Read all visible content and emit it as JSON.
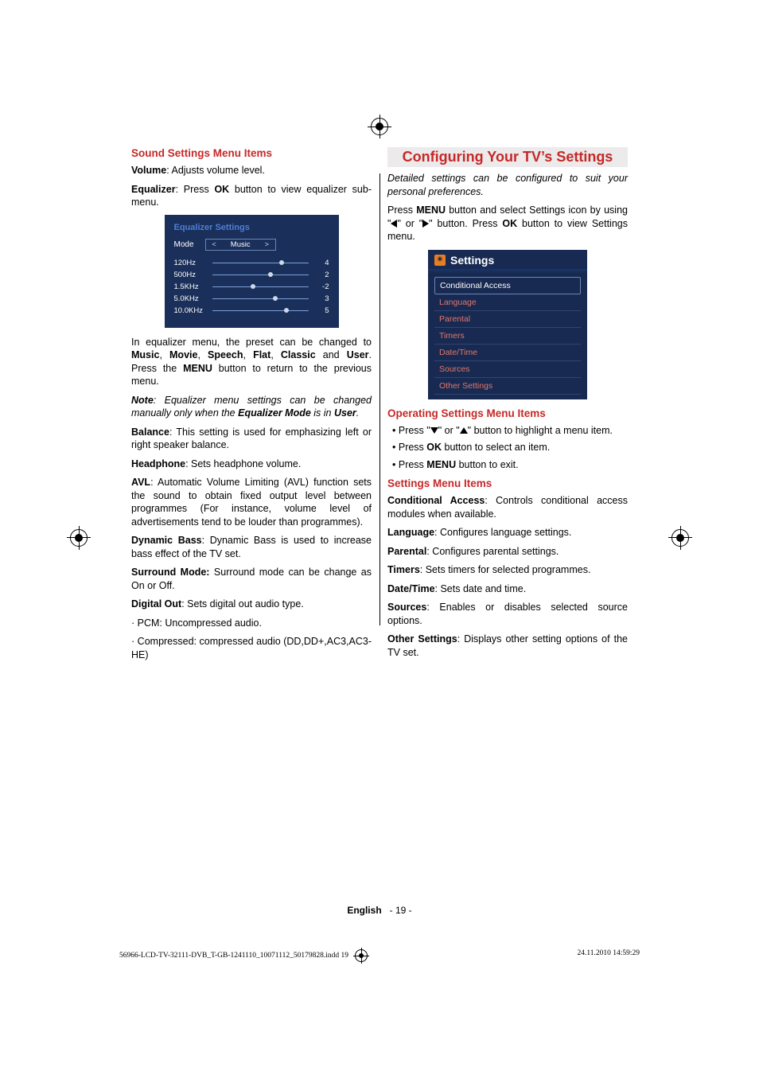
{
  "left": {
    "heading_sound": "Sound Settings Menu Items",
    "p_volume_b": "Volume",
    "p_volume_rest": ": Adjusts volume level.",
    "p_equalizer_b": "Equalizer",
    "p_equalizer_mid1": ": Press ",
    "p_equalizer_ok": "OK",
    "p_equalizer_rest": " button to view equalizer sub-menu.",
    "eq": {
      "title": "Equalizer Settings",
      "mode_label": "Mode",
      "mode_value": "Music",
      "bands": [
        {
          "label": "120Hz",
          "value": "4",
          "dot_pct": 70
        },
        {
          "label": "500Hz",
          "value": "2",
          "dot_pct": 58
        },
        {
          "label": "1.5KHz",
          "value": "-2",
          "dot_pct": 40
        },
        {
          "label": "5.0KHz",
          "value": "3",
          "dot_pct": 63
        },
        {
          "label": "10.0KHz",
          "value": "5",
          "dot_pct": 75
        }
      ]
    },
    "p_inmenu_1": "In equalizer menu, the preset can be changed to ",
    "p_inmenu_music": "Music",
    "p_inmenu_c": ", ",
    "p_inmenu_movie": "Movie",
    "p_inmenu_speech": "Speech",
    "p_inmenu_flat": "Flat",
    "p_inmenu_classic": "Classic",
    "p_inmenu_and": " and ",
    "p_inmenu_user": "User",
    "p_inmenu_2a": ". Press the ",
    "p_inmenu_menu": "MENU",
    "p_inmenu_2b": " button to return to the previous menu.",
    "note_label": "Note",
    "note_1": ": Equalizer menu settings can be changed manually only when the ",
    "note_eqmode": "Equalizer Mode",
    "note_isin": " is in ",
    "note_user": "User",
    "note_dot": ".",
    "balance_b": "Balance",
    "balance_rest": ": This setting is used for emphasizing left or right speaker balance.",
    "headphone_b": "Headphone",
    "headphone_rest": ": Sets headphone volume.",
    "avl_b": "AVL",
    "avl_rest": ": Automatic Volume Limiting (AVL) function sets the sound to obtain fixed output level between programmes (For instance, volume level of advertisements tend to be louder than programmes).",
    "dyn_b": "Dynamic Bass",
    "dyn_rest": ": Dynamic Bass is used to increase bass effect of the TV set.",
    "surround_b": "Surround Mode:",
    "surround_rest": " Surround mode can be change as On or Off.",
    "digital_b": "Digital Out",
    "digital_rest": ": Sets digital out audio type.",
    "pcm": "· PCM: Uncompressed audio.",
    "compressed": "· Compressed: compressed audio (DD,DD+,AC3,AC3-HE)"
  },
  "right": {
    "banner": "Configuring Your TV’s Settings",
    "detailed": "Detailed settings can be configured to suit your personal preferences.",
    "p_press1": "Press ",
    "p_menu": "MENU",
    "p_press2": " button and select Settings icon by using \"",
    "p_or": "\" or \"",
    "p_press3": "\" button. Press ",
    "p_ok": "OK",
    "p_press4": " button to view Settings menu.",
    "settings_title": "Settings",
    "settings_items": [
      "Conditional Access",
      "Language",
      "Parental",
      "Timers",
      "Date/Time",
      "Sources",
      "Other Settings"
    ],
    "op_heading": "Operating Settings Menu Items",
    "op_b1a": "Press \"",
    "op_b1b": "\" or \"",
    "op_b1c": "\" button to highlight a menu item.",
    "op_b2a": "Press ",
    "op_b2ok": "OK",
    "op_b2b": " button to select an item.",
    "op_b3a": "Press ",
    "op_b3menu": "MENU",
    "op_b3b": " button to exit.",
    "items_heading": "Settings Menu Items",
    "ca_b": "Conditional Access",
    "ca_rest": ": Controls conditional access modules when available.",
    "lang_b": "Language",
    "lang_rest": ": Configures language settings.",
    "par_b": "Parental",
    "par_rest": ": Configures parental settings.",
    "tim_b": "Timers",
    "tim_rest": ": Sets timers for selected programmes.",
    "dt_b": "Date/Time",
    "dt_rest": ": Sets date and time.",
    "src_b": "Sources",
    "src_rest": ": Enables or disables selected source options.",
    "oth_b": "Other Settings",
    "oth_rest": ": Displays other setting options of the TV set."
  },
  "footer": {
    "lang": "English",
    "page": "- 19 -",
    "filename": "56966-LCD-TV-32111-DVB_T-GB-1241110_10071112_50179828.indd   19",
    "datetime": "24.11.2010   14:59:29"
  }
}
